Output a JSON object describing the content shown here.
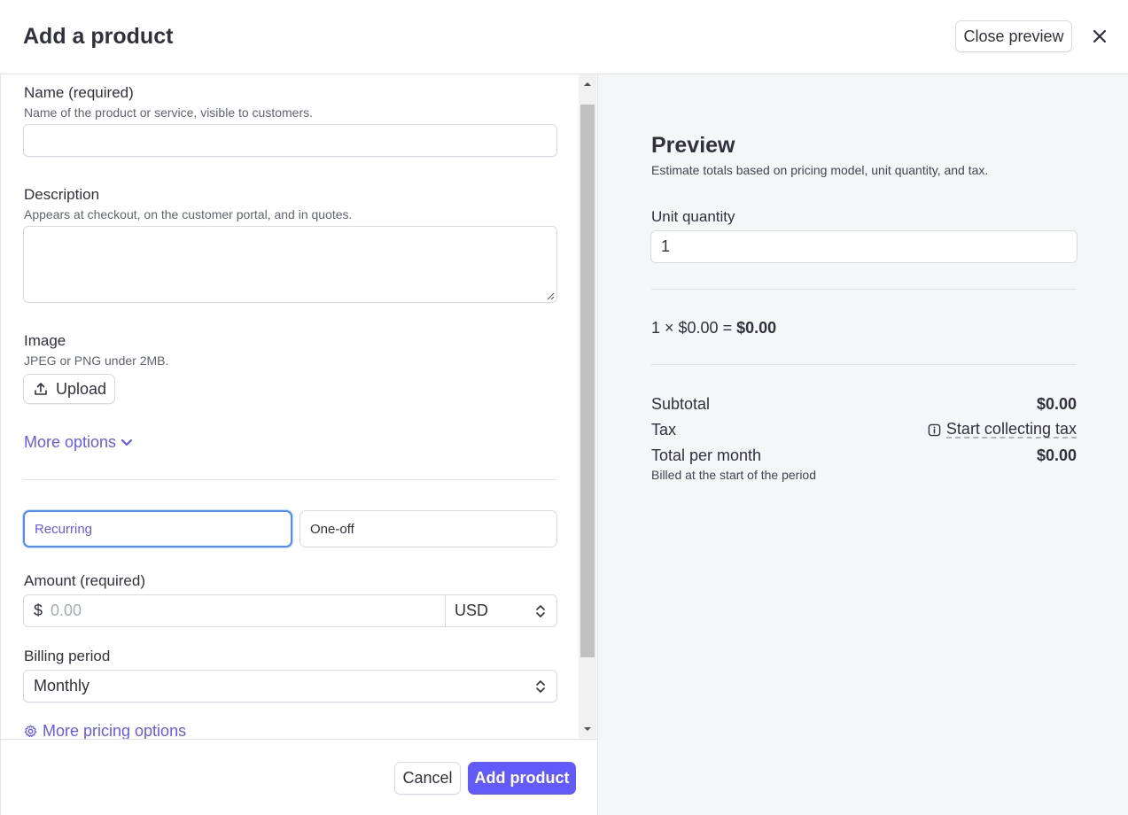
{
  "header": {
    "title": "Add a product",
    "close_preview_label": "Close preview"
  },
  "form": {
    "name": {
      "label": "Name (required)",
      "hint": "Name of the product or service, visible to customers.",
      "value": ""
    },
    "description": {
      "label": "Description",
      "hint": "Appears at checkout, on the customer portal, and in quotes.",
      "value": ""
    },
    "image": {
      "label": "Image",
      "hint": "JPEG or PNG under 2MB.",
      "upload_label": "Upload"
    },
    "more_options_label": "More options",
    "pricing_type": {
      "options": [
        "Recurring",
        "One-off"
      ],
      "selected": "Recurring"
    },
    "amount": {
      "label": "Amount (required)",
      "currency_symbol": "$",
      "placeholder": "0.00",
      "currency": "USD"
    },
    "billing_period": {
      "label": "Billing period",
      "value": "Monthly"
    },
    "more_pricing_options_label": "More pricing options"
  },
  "footer": {
    "cancel_label": "Cancel",
    "add_label": "Add product"
  },
  "preview": {
    "title": "Preview",
    "subtitle": "Estimate totals based on pricing model, unit quantity, and tax.",
    "unit_quantity_label": "Unit quantity",
    "unit_quantity_value": "1",
    "calc_expression": "1 × $0.00 = ",
    "calc_result": "$0.00",
    "subtotal_label": "Subtotal",
    "subtotal_value": "$0.00",
    "tax_label": "Tax",
    "tax_link": "Start collecting tax",
    "total_label": "Total per month",
    "total_value": "$0.00",
    "billed_note": "Billed at the start of the period"
  },
  "colors": {
    "accent": "#625afa",
    "focus_ring": "#4f8cf7",
    "preview_bg": "#f5f6f8",
    "text": "#30313d"
  }
}
